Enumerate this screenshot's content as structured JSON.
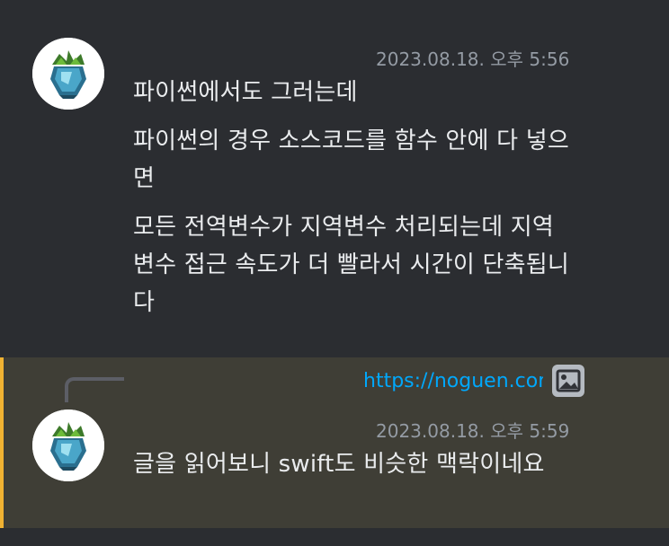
{
  "messages": [
    {
      "avatar_icon": "leaf-gem-avatar",
      "timestamp": "2023.08.18. 오후 5:56",
      "lines": [
        "파이썬에서도 그러는데",
        "파이썬의 경우 소스코드를 함수 안에 다 넣으면",
        "모든 전역변수가 지역변수 처리되는데 지역변수 접근 속도가 더 빨라서 시간이 단축됩니다"
      ]
    },
    {
      "avatar_icon": "leaf-gem-avatar",
      "timestamp": "2023.08.18. 오후 5:59",
      "reply": {
        "link_text": "https://noguen.com",
        "attachment_icon": "image-icon"
      },
      "lines": [
        "글을 읽어보니 swift도 비슷한 맥락이네요"
      ]
    }
  ],
  "colors": {
    "background": "#313338",
    "message_bg": "#2b2d31",
    "highlight_bg": "#3f3e36",
    "highlight_bar": "#f0b232",
    "link": "#00a8fc",
    "timestamp": "#949ba4"
  }
}
